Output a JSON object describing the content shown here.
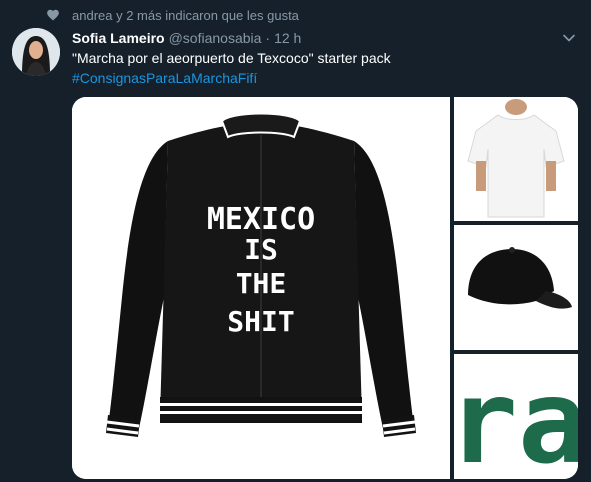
{
  "social_context": {
    "text": "andrea y 2 más indicaron que les gusta"
  },
  "tweet": {
    "display_name": "Sofia Lameiro",
    "handle": "@sofianosabia",
    "separator": "·",
    "time": "12 h",
    "text": "\"Marcha por el aeorpuerto de Texcoco\" starter pack",
    "hashtag": "#ConsignasParaLaMarchaFifí"
  },
  "media": {
    "jacket": {
      "lines": [
        "MEXICO",
        "IS",
        "THE",
        "SHIT"
      ]
    },
    "tile_3_text": "ra"
  },
  "colors": {
    "background": "#15202b",
    "muted": "#8899a6",
    "link": "#1b95e0",
    "logo_green": "#1d6b4a"
  }
}
